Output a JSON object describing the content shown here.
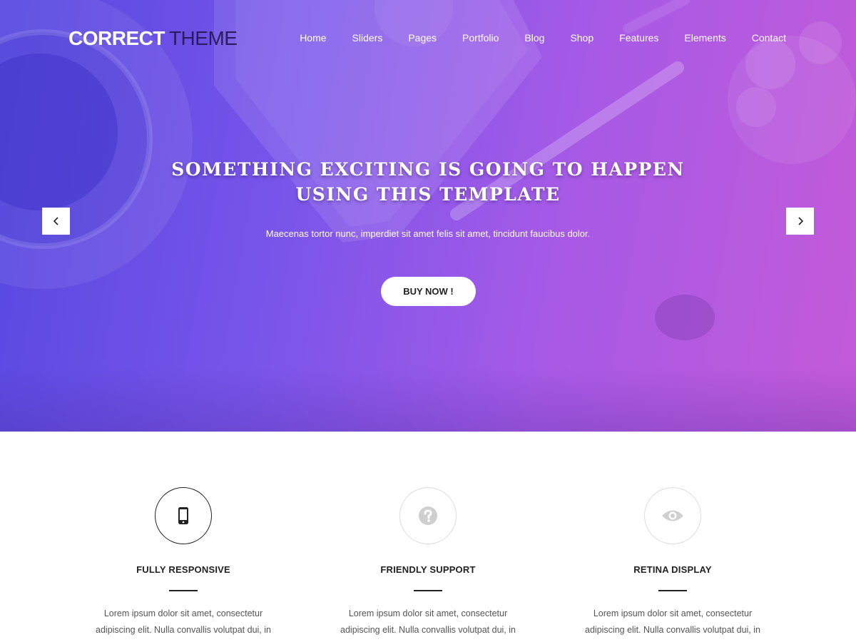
{
  "logo": {
    "strong": "CORRECT",
    "light": "THEME"
  },
  "nav": [
    "Home",
    "Sliders",
    "Pages",
    "Portfolio",
    "Blog",
    "Shop",
    "Features",
    "Elements",
    "Contact"
  ],
  "hero": {
    "title_line1": "SOMETHING EXCITING IS GOING TO HAPPEN",
    "title_line2": "USING THIS TEMPLATE",
    "subtitle": "Maecenas tortor nunc, imperdiet sit amet felis sit amet, tincidunt faucibus dolor.",
    "button": "BUY NOW !",
    "prev_icon": "chevron-left-icon",
    "next_icon": "chevron-right-icon"
  },
  "features": [
    {
      "icon": "mobile-phone-icon",
      "title": "FULLY RESPONSIVE",
      "text": "Lorem ipsum dolor sit amet, consectetur adipiscing elit. Nulla convallis volutpat dui, in"
    },
    {
      "icon": "question-circle-icon",
      "title": "FRIENDLY SUPPORT",
      "text": "Lorem ipsum dolor sit amet, consectetur adipiscing elit. Nulla convallis volutpat dui, in"
    },
    {
      "icon": "eye-icon",
      "title": "RETINA DISPLAY",
      "text": "Lorem ipsum dolor sit amet, consectetur adipiscing elit. Nulla convallis volutpat dui, in"
    }
  ],
  "colors": {
    "hero_start": "#5548e0",
    "hero_end": "#c45ad8",
    "accent_dark": "#222222"
  }
}
